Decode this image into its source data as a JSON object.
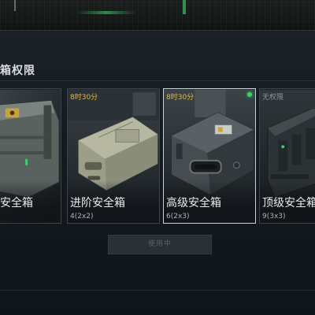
{
  "section": {
    "title": "箱权限"
  },
  "cards": [
    {
      "name": "安全箱",
      "sub": "",
      "timer": "",
      "selected": false
    },
    {
      "name": "进阶安全箱",
      "sub": "4(2x2)",
      "timer": "8时30分",
      "selected": false
    },
    {
      "name": "高级安全箱",
      "sub": "6(2x3)",
      "timer": "8时30分",
      "selected": true,
      "status_color": "#38d46a"
    },
    {
      "name": "顶级安全箱",
      "sub": "9(3x3)",
      "timer": "无权限",
      "selected": false
    }
  ],
  "use_button": {
    "label": "使用中"
  },
  "colors": {
    "background": "#0c1014",
    "panel": "#1b2127",
    "timer": "#e0b64a",
    "status_green": "#38d46a",
    "selected_border": "#c9d2d6"
  }
}
